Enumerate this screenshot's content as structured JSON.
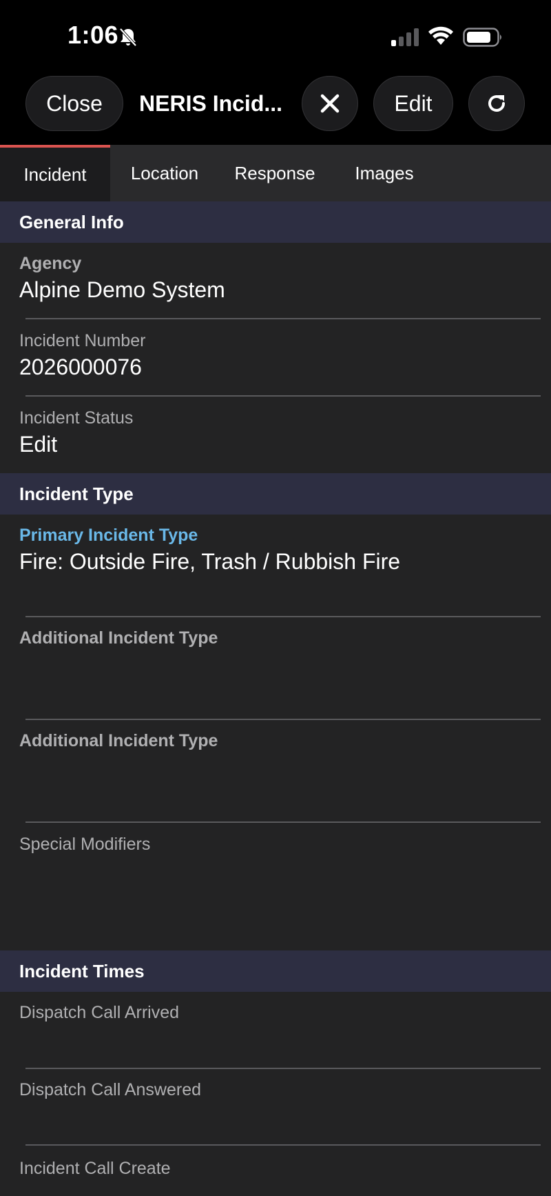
{
  "status_bar": {
    "time": "1:06"
  },
  "toolbar": {
    "close_label": "Close",
    "title": "NERIS Incid...",
    "edit_label": "Edit"
  },
  "tabs": [
    {
      "label": "Incident",
      "active": true
    },
    {
      "label": "Location",
      "active": false
    },
    {
      "label": "Response",
      "active": false
    },
    {
      "label": "Images",
      "active": false
    }
  ],
  "sections": {
    "general_info": {
      "title": "General Info",
      "agency_label": "Agency",
      "agency_value": "Alpine Demo System",
      "incident_number_label": "Incident Number",
      "incident_number_value": "2026000076",
      "incident_status_label": "Incident Status",
      "incident_status_value": "Edit"
    },
    "incident_type": {
      "title": "Incident Type",
      "primary_label": "Primary Incident Type",
      "primary_value": "Fire: Outside Fire, Trash / Rubbish Fire",
      "additional_1_label": "Additional Incident Type",
      "additional_1_value": "",
      "additional_2_label": "Additional Incident Type",
      "additional_2_value": "",
      "special_modifiers_label": "Special Modifiers",
      "special_modifiers_value": ""
    },
    "incident_times": {
      "title": "Incident Times",
      "dispatch_arrived_label": "Dispatch Call Arrived",
      "dispatch_arrived_value": "",
      "dispatch_answered_label": "Dispatch Call Answered",
      "dispatch_answered_value": "",
      "call_create_label": "Incident Call Create"
    }
  },
  "colors": {
    "accent_tab": "#d9534f",
    "section_header_bg": "#2d2e42",
    "focused_label": "#6ab8e8"
  }
}
